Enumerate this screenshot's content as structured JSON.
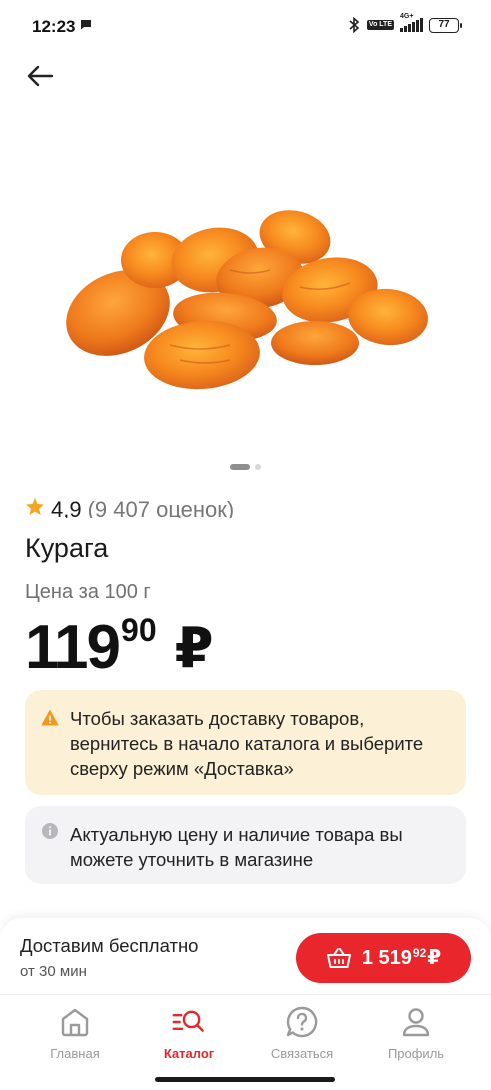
{
  "status_bar": {
    "time": "12:23",
    "network": "4G+",
    "volte": "Vo LTE",
    "battery": "77"
  },
  "product": {
    "rating_value": "4,9",
    "rating_count": "(9 407 оценок)",
    "title": "Курага",
    "price_unit": "Цена за 100 г",
    "price_rub": "119",
    "price_kop": "90",
    "currency": "₽",
    "image_icon": "dried-apricots-image",
    "pager": {
      "total": 2,
      "active": 1
    }
  },
  "notices": {
    "warning": "Чтобы заказать доставку товаров, вернитесь в начало каталога и выберите сверху режим «Доставка»",
    "info": "Актуальную цену и наличие товара вы можете уточнить в магазине"
  },
  "delivery": {
    "title": "Доставим бесплатно",
    "subtitle": "от 30 мин",
    "cart_rub": "1 519",
    "cart_kop": "92",
    "cart_currency": "₽"
  },
  "nav": {
    "items": [
      {
        "label": "Главная",
        "icon": "home-icon"
      },
      {
        "label": "Каталог",
        "icon": "catalog-search-icon",
        "active": true
      },
      {
        "label": "Связаться",
        "icon": "support-chat-icon"
      },
      {
        "label": "Профиль",
        "icon": "profile-icon"
      }
    ]
  },
  "colors": {
    "accent": "#e8262b",
    "star": "#f5a524",
    "warning_bg": "#fcf1d6",
    "info_bg": "#f3f3f5"
  }
}
